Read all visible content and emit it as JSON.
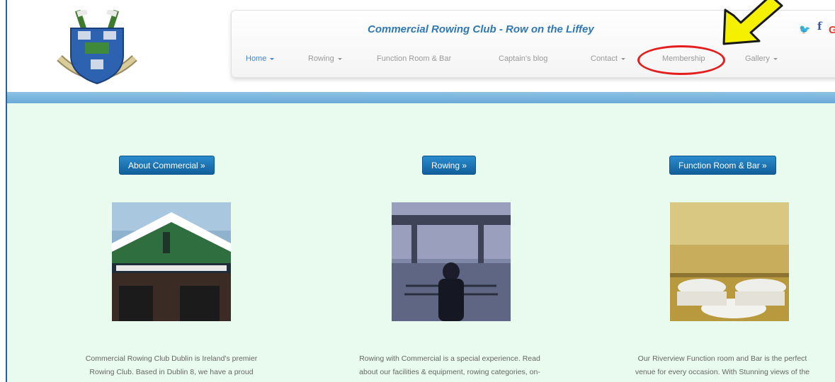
{
  "header": {
    "title": "Commercial Rowing Club - Row on the Liffey",
    "nav": [
      {
        "label": "Home",
        "caret": true,
        "active": true
      },
      {
        "label": "Rowing",
        "caret": true,
        "active": false
      },
      {
        "label": "Function Room & Bar",
        "caret": false,
        "active": false
      },
      {
        "label": "Captain's blog",
        "caret": false,
        "active": false
      },
      {
        "label": "Contact",
        "caret": true,
        "active": false
      },
      {
        "label": "Membership",
        "caret": false,
        "active": false
      },
      {
        "label": "Gallery",
        "caret": true,
        "active": false
      }
    ],
    "social": {
      "twitter": "twitter-icon",
      "facebook": "facebook-icon",
      "google": "google-plus-icon"
    }
  },
  "main": {
    "columns": [
      {
        "button": "About Commercial »",
        "image": "club-building-photo",
        "caption_line1": "Commercial Rowing Club Dublin is Ireland's premier",
        "caption_line2": "Rowing Club. Based in Dublin 8, we have a proud"
      },
      {
        "button": "Rowing »",
        "image": "rower-on-river-photo",
        "caption_line1": "Rowing with Commercial is a special experience. Read",
        "caption_line2": "about our facilities & equipment, rowing categories, on-"
      },
      {
        "button": "Function Room & Bar »",
        "image": "function-room-photo",
        "caption_line1": "Our Riverview Function room and Bar is the perfect",
        "caption_line2": "venue for every occasion. With Stunning views of the"
      }
    ]
  },
  "colors": {
    "accent": "#2f78b3",
    "button": "#1a6fb0",
    "band": "#7ab6de",
    "content_bg": "#e9fbee",
    "annotation_circle": "#e41e1e",
    "annotation_arrow": "#f5f000"
  }
}
